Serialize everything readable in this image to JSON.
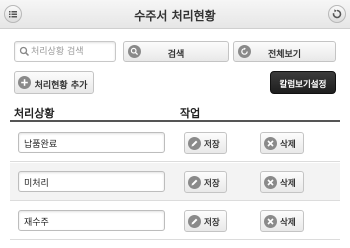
{
  "header": {
    "title": "수주서 처리현황",
    "menu_icon": "list-icon",
    "back_icon": "refresh-icon"
  },
  "search": {
    "placeholder": "처리상황 검색",
    "value": "",
    "search_label": "검색",
    "view_all_label": "전체보기"
  },
  "toolbar": {
    "add_label": "처리현황 추가",
    "column_settings_label": "칼럼보기설정"
  },
  "table": {
    "headers": [
      "처리상황",
      "작업"
    ],
    "rows": [
      {
        "value": "납품완료",
        "save_label": "저장",
        "delete_label": "삭제"
      },
      {
        "value": "미처리",
        "save_label": "저장",
        "delete_label": "삭제"
      },
      {
        "value": "재수주",
        "save_label": "저장",
        "delete_label": "삭제"
      }
    ]
  },
  "colors": {
    "icon_gray": "#8a8a8a",
    "dark_button": "#2a2a2a"
  }
}
